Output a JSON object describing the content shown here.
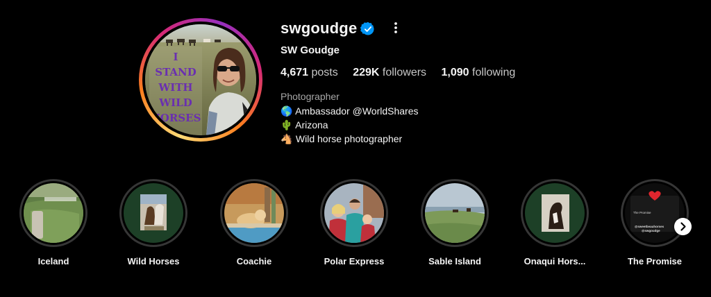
{
  "profile": {
    "username": "swgoudge",
    "full_name": "SW Goudge",
    "verified": true,
    "avatar_sign_text": [
      "I",
      "STAND",
      "WITH",
      "WILD",
      "HORSES"
    ],
    "stats": {
      "posts_count": "4,671",
      "posts_label": "posts",
      "followers_count": "229K",
      "followers_label": "followers",
      "following_count": "1,090",
      "following_label": "following"
    },
    "category": "Photographer",
    "bio": [
      {
        "emoji": "🌎",
        "text": "Ambassador @WorldShares"
      },
      {
        "emoji": "🌵",
        "text": "Arizona"
      },
      {
        "emoji": "🐴",
        "text": "Wild horse photographer"
      }
    ]
  },
  "highlights": [
    {
      "label": "Iceland",
      "icon": "iceland-landscape"
    },
    {
      "label": "Wild Horses",
      "icon": "horses-on-green"
    },
    {
      "label": "Coachie",
      "icon": "dog-by-pool"
    },
    {
      "label": "Polar Express",
      "icon": "family-photo"
    },
    {
      "label": "Sable Island",
      "icon": "island-horses"
    },
    {
      "label": "Onaqui Hors...",
      "icon": "horse-on-green"
    },
    {
      "label": "The Promise",
      "icon": "post-screenshot"
    }
  ],
  "promise_card": {
    "title": "The Promise",
    "handle1": "@sweetbeauhorses",
    "handle2": "@swgoudge"
  },
  "colors": {
    "background": "#000000",
    "text_primary": "#f5f5f5",
    "text_secondary": "#a8a8a8",
    "verified_blue": "#0095f6",
    "highlight_ring": "#363636",
    "dark_green": "#1d4027"
  }
}
